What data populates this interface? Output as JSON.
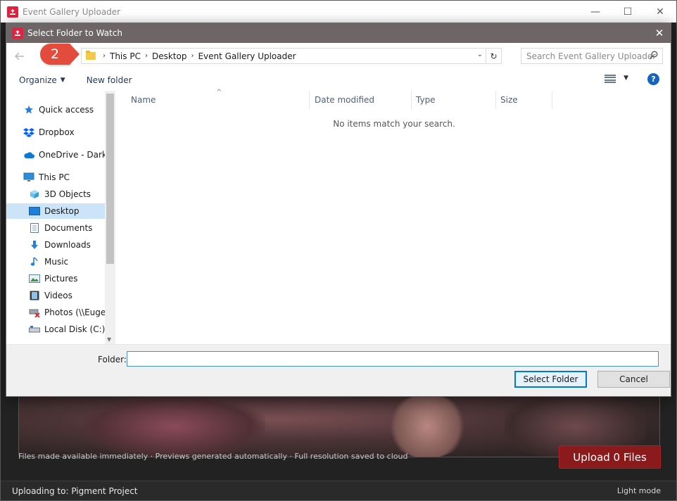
{
  "app": {
    "title": "Event Gallery Uploader",
    "minimize_glyph": "—",
    "maximize_glyph": "☐",
    "close_glyph": "✕",
    "info_text": "Files made available immediately · Previews generated automatically · Full resolution saved to cloud",
    "upload_button_label": "Upload 0 Files",
    "status_left": "Uploading to: Pigment Project",
    "status_right": "Light mode"
  },
  "dialog": {
    "title": "Select Folder to Watch",
    "close_glyph": "✕",
    "badge_number": "2",
    "breadcrumbs": [
      "This PC",
      "Desktop",
      "Event Gallery Uploader"
    ],
    "search_placeholder": "Search Event Gallery Uploader",
    "toolbar": {
      "organize_label": "Organize",
      "new_folder_label": "New folder"
    },
    "nav_items": [
      {
        "label": "Quick access",
        "icon": "star-icon"
      },
      {
        "label": "Dropbox",
        "icon": "dropbox-icon"
      },
      {
        "label": "OneDrive - Darkro",
        "icon": "onedrive-icon"
      },
      {
        "label": "This PC",
        "icon": "this-pc-icon"
      },
      {
        "label": "3D Objects",
        "icon": "3d-objects-icon"
      },
      {
        "label": "Desktop",
        "icon": "desktop-icon",
        "selected": true
      },
      {
        "label": "Documents",
        "icon": "documents-icon"
      },
      {
        "label": "Downloads",
        "icon": "downloads-icon"
      },
      {
        "label": "Music",
        "icon": "music-icon"
      },
      {
        "label": "Pictures",
        "icon": "pictures-icon"
      },
      {
        "label": "Videos",
        "icon": "videos-icon"
      },
      {
        "label": "Photos (\\\\Eugen",
        "icon": "network-drive-icon"
      },
      {
        "label": "Local Disk (C:)",
        "icon": "local-disk-icon"
      }
    ],
    "columns": [
      "Name",
      "Date modified",
      "Type",
      "Size"
    ],
    "empty_message": "No items match your search.",
    "folder_label": "Folder:",
    "folder_value": "",
    "select_button_label": "Select Folder",
    "cancel_button_label": "Cancel"
  },
  "colors": {
    "accent_red": "#e0233f",
    "upload_button": "#8b1a1c",
    "selection_blue": "#cce4f7",
    "primary_button_border": "#0078d7",
    "badge": "#e34b3c"
  }
}
